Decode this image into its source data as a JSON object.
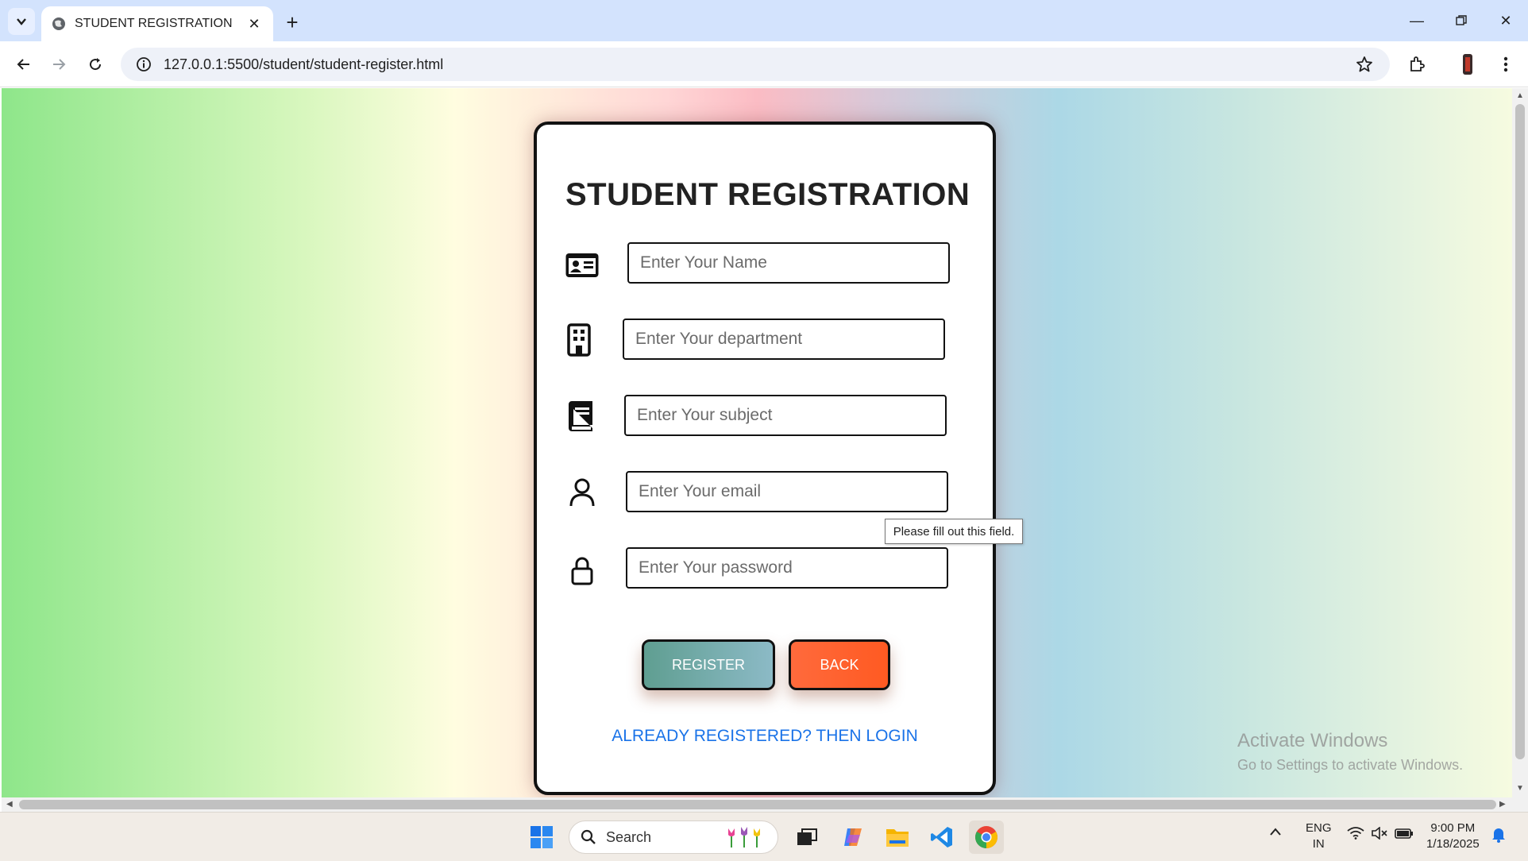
{
  "browser": {
    "tab_title": "STUDENT REGISTRATION",
    "url": "127.0.0.1:5500/student/student-register.html"
  },
  "form": {
    "title": "STUDENT REGISTRATION",
    "fields": {
      "name": {
        "placeholder": "Enter Your Name",
        "icon": "id-card-icon"
      },
      "department": {
        "placeholder": "Enter Your department",
        "icon": "building-icon"
      },
      "subject": {
        "placeholder": "Enter Your subject",
        "icon": "book-icon"
      },
      "email": {
        "placeholder": "Enter Your email",
        "icon": "user-icon"
      },
      "password": {
        "placeholder": "Enter Your password",
        "icon": "lock-icon"
      }
    },
    "validation_tooltip": "Please fill out this field.",
    "register_label": "REGISTER",
    "back_label": "BACK",
    "login_link": "ALREADY REGISTERED? THEN LOGIN"
  },
  "watermark": {
    "title": "Activate Windows",
    "subtitle": "Go to Settings to activate Windows."
  },
  "taskbar": {
    "search_label": "Search",
    "language": "ENG",
    "region": "IN",
    "time": "9:00 PM",
    "date": "1/18/2025"
  },
  "colors": {
    "register_button": "#6fa8a4",
    "back_button": "#ff6230",
    "link": "#1a73e8"
  }
}
